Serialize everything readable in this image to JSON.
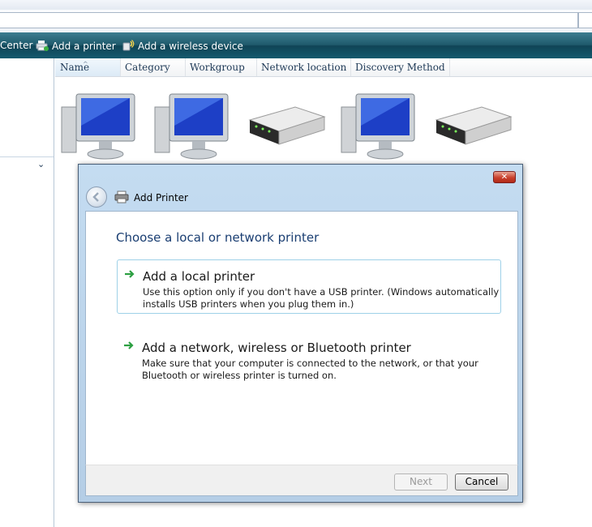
{
  "toolbar": {
    "network_center_label": "Center",
    "add_printer_label": "Add a printer",
    "add_wireless_label": "Add a wireless device"
  },
  "columns": [
    "Name",
    "Category",
    "Workgroup",
    "Network location",
    "Discovery Method"
  ],
  "devices": [
    {
      "type": "computer-icon"
    },
    {
      "type": "computer-icon"
    },
    {
      "type": "router-icon"
    },
    {
      "type": "computer-icon"
    },
    {
      "type": "router-icon"
    }
  ],
  "dialog": {
    "title": "Add Printer",
    "heading": "Choose a local or network printer",
    "options": [
      {
        "title": "Add a local printer",
        "description": "Use this option only if you don't have a USB printer. (Windows automatically installs USB printers when you plug them in.)"
      },
      {
        "title": "Add a network, wireless or Bluetooth printer",
        "description": "Make sure that your computer is connected to the network, or that your Bluetooth or wireless printer is turned on."
      }
    ],
    "next_label": "Next",
    "cancel_label": "Cancel",
    "close_glyph": "✕"
  },
  "colors": {
    "accent": "#1a3e72",
    "toolbar": "#1f5a6c",
    "arrow": "#2ea043"
  }
}
